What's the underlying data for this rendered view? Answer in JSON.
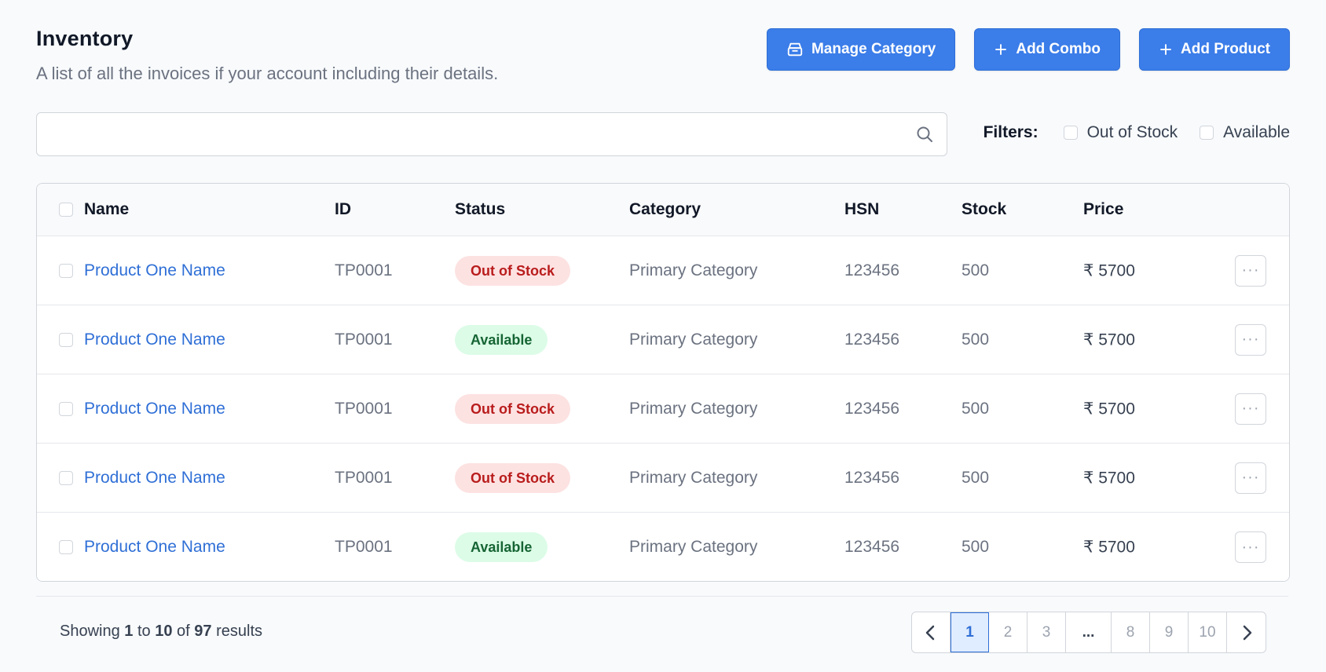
{
  "header": {
    "title": "Inventory",
    "subtitle": "A list of all the invoices if your account including their details."
  },
  "actions": {
    "manage_category": "Manage Category",
    "add_combo": "Add Combo",
    "add_product": "Add Product"
  },
  "search": {
    "placeholder": "",
    "value": ""
  },
  "filters": {
    "label": "Filters:",
    "options": [
      {
        "label": "Out of Stock",
        "checked": false
      },
      {
        "label": "Available",
        "checked": false
      }
    ]
  },
  "table": {
    "columns": {
      "name": "Name",
      "id": "ID",
      "status": "Status",
      "category": "Category",
      "hsn": "HSN",
      "stock": "Stock",
      "price": "Price"
    },
    "rows": [
      {
        "name": "Product One Name",
        "id": "TP0001",
        "status": "Out of Stock",
        "status_type": "out",
        "category": "Primary Category",
        "hsn": "123456",
        "stock": "500",
        "price": "₹ 5700"
      },
      {
        "name": "Product One Name",
        "id": "TP0001",
        "status": "Available",
        "status_type": "avail",
        "category": "Primary Category",
        "hsn": "123456",
        "stock": "500",
        "price": "₹ 5700"
      },
      {
        "name": "Product One Name",
        "id": "TP0001",
        "status": "Out of Stock",
        "status_type": "out",
        "category": "Primary Category",
        "hsn": "123456",
        "stock": "500",
        "price": "₹ 5700"
      },
      {
        "name": "Product One Name",
        "id": "TP0001",
        "status": "Out of Stock",
        "status_type": "out",
        "category": "Primary Category",
        "hsn": "123456",
        "stock": "500",
        "price": "₹ 5700"
      },
      {
        "name": "Product One Name",
        "id": "TP0001",
        "status": "Available",
        "status_type": "avail",
        "category": "Primary Category",
        "hsn": "123456",
        "stock": "500",
        "price": "₹ 5700"
      }
    ],
    "row_menu_glyph": "···"
  },
  "footer": {
    "results_prefix": "Showing",
    "results_from": "1",
    "results_to_word": "to",
    "results_to": "10",
    "results_of_word": "of",
    "results_total": "97",
    "results_suffix": "results"
  },
  "pagination": {
    "pages": [
      "1",
      "2",
      "3",
      "...",
      "8",
      "9",
      "10"
    ],
    "current": "1"
  },
  "colors": {
    "primary": "#3b7de9",
    "link": "#2f6fd6",
    "out_of_stock_bg": "#fde2e2",
    "out_of_stock_text": "#b91c1c",
    "available_bg": "#dcfce7",
    "available_text": "#166534"
  }
}
